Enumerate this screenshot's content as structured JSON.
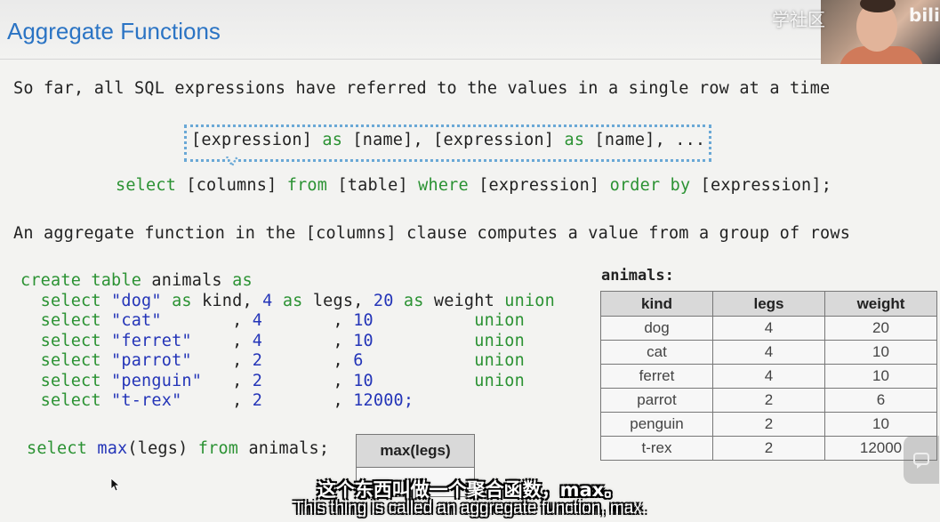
{
  "slide": {
    "title": "Aggregate Functions",
    "intro": "So far, all SQL expressions have referred to the values in a single row at a time",
    "expr_tokens": [
      {
        "t": "[expression] ",
        "c": "dark"
      },
      {
        "t": "as",
        "c": "green"
      },
      {
        "t": " [name], [expression] ",
        "c": "dark"
      },
      {
        "t": "as",
        "c": "green"
      },
      {
        "t": " [name], ...",
        "c": "dark"
      }
    ],
    "select_tokens": [
      {
        "t": "select",
        "c": "green"
      },
      {
        "t": " [columns] ",
        "c": "dark"
      },
      {
        "t": "from",
        "c": "green"
      },
      {
        "t": " [table] ",
        "c": "dark"
      },
      {
        "t": "where",
        "c": "green"
      },
      {
        "t": " [expression] ",
        "c": "dark"
      },
      {
        "t": "order by",
        "c": "green"
      },
      {
        "t": " [expression];",
        "c": "dark"
      }
    ],
    "aggregate_line": "An aggregate function in the [columns] clause computes a value from a group of rows",
    "code_lines": [
      [
        {
          "t": "create table ",
          "c": "green"
        },
        {
          "t": "animals ",
          "c": "dark"
        },
        {
          "t": "as",
          "c": "green"
        }
      ],
      [
        {
          "t": "  select ",
          "c": "green"
        },
        {
          "t": "\"dog\"",
          "c": "blue"
        },
        {
          "t": " as ",
          "c": "green"
        },
        {
          "t": "kind, ",
          "c": "dark"
        },
        {
          "t": "4",
          "c": "blue"
        },
        {
          "t": " as ",
          "c": "green"
        },
        {
          "t": "legs, ",
          "c": "dark"
        },
        {
          "t": "20",
          "c": "blue"
        },
        {
          "t": " as ",
          "c": "green"
        },
        {
          "t": "weight ",
          "c": "dark"
        },
        {
          "t": "union",
          "c": "green"
        }
      ],
      [
        {
          "t": "  select ",
          "c": "green"
        },
        {
          "t": "\"cat\"",
          "c": "blue"
        },
        {
          "t": "       , ",
          "c": "dark"
        },
        {
          "t": "4",
          "c": "blue"
        },
        {
          "t": "       , ",
          "c": "dark"
        },
        {
          "t": "10",
          "c": "blue"
        },
        {
          "t": "          ",
          "c": "dark"
        },
        {
          "t": "union",
          "c": "green"
        }
      ],
      [
        {
          "t": "  select ",
          "c": "green"
        },
        {
          "t": "\"ferret\"",
          "c": "blue"
        },
        {
          "t": "    , ",
          "c": "dark"
        },
        {
          "t": "4",
          "c": "blue"
        },
        {
          "t": "       , ",
          "c": "dark"
        },
        {
          "t": "10",
          "c": "blue"
        },
        {
          "t": "          ",
          "c": "dark"
        },
        {
          "t": "union",
          "c": "green"
        }
      ],
      [
        {
          "t": "  select ",
          "c": "green"
        },
        {
          "t": "\"parrot\"",
          "c": "blue"
        },
        {
          "t": "    , ",
          "c": "dark"
        },
        {
          "t": "2",
          "c": "blue"
        },
        {
          "t": "       , ",
          "c": "dark"
        },
        {
          "t": "6",
          "c": "blue"
        },
        {
          "t": "           ",
          "c": "dark"
        },
        {
          "t": "union",
          "c": "green"
        }
      ],
      [
        {
          "t": "  select ",
          "c": "green"
        },
        {
          "t": "\"penguin\"",
          "c": "blue"
        },
        {
          "t": "   , ",
          "c": "dark"
        },
        {
          "t": "2",
          "c": "blue"
        },
        {
          "t": "       , ",
          "c": "dark"
        },
        {
          "t": "10",
          "c": "blue"
        },
        {
          "t": "          ",
          "c": "dark"
        },
        {
          "t": "union",
          "c": "green"
        }
      ],
      [
        {
          "t": "  select ",
          "c": "green"
        },
        {
          "t": "\"t-rex\"",
          "c": "blue"
        },
        {
          "t": "     , ",
          "c": "dark"
        },
        {
          "t": "2",
          "c": "blue"
        },
        {
          "t": "       , ",
          "c": "dark"
        },
        {
          "t": "12000;",
          "c": "blue"
        }
      ]
    ],
    "max_query": [
      {
        "t": "select ",
        "c": "green"
      },
      {
        "t": "max",
        "c": "blue"
      },
      {
        "t": "(legs) ",
        "c": "dark"
      },
      {
        "t": "from ",
        "c": "green"
      },
      {
        "t": "animals;",
        "c": "dark"
      }
    ],
    "animals_title": "animals:",
    "animals_headers": [
      "kind",
      "legs",
      "weight"
    ],
    "animals_rows": [
      [
        "dog",
        "4",
        "20"
      ],
      [
        "cat",
        "4",
        "10"
      ],
      [
        "ferret",
        "4",
        "10"
      ],
      [
        "parrot",
        "2",
        "6"
      ],
      [
        "penguin",
        "2",
        "10"
      ],
      [
        "t-rex",
        "2",
        "12000"
      ]
    ],
    "max_table_header": "max(legs)"
  },
  "overlay": {
    "subtitle_cn": "这个东西叫做一个聚合函数，max。",
    "subtitle_en": "This thing is called an aggregate function, max.",
    "watermark": "学社区",
    "watermark_mark": "bilib"
  },
  "colors": {
    "green": "#2b9233",
    "blue": "#2435b8",
    "title": "#2b74c4"
  }
}
